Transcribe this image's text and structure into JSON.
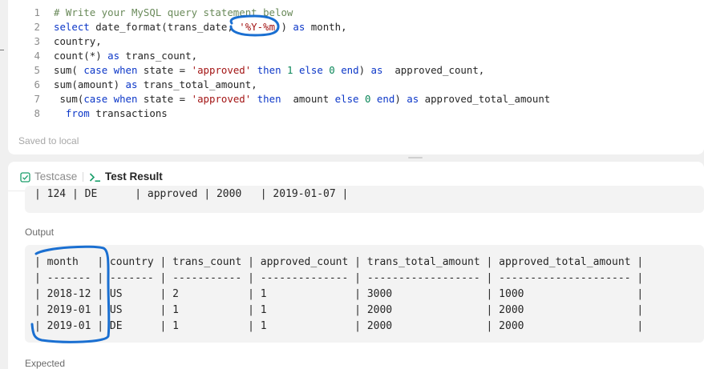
{
  "editor": {
    "lines": [
      {
        "no": "1",
        "tokens": [
          {
            "t": "# Write your MySQL query statement below",
            "c": "tok-comment"
          }
        ]
      },
      {
        "no": "2",
        "tokens": [
          {
            "t": "select",
            "c": "tok-kw"
          },
          {
            "t": " date_format(trans_date, ",
            "c": ""
          },
          {
            "t": "'%Y-%m'",
            "c": "tok-str"
          },
          {
            "t": ") ",
            "c": ""
          },
          {
            "t": "as",
            "c": "tok-kw"
          },
          {
            "t": " month,",
            "c": ""
          }
        ]
      },
      {
        "no": "3",
        "tokens": [
          {
            "t": "country,",
            "c": ""
          }
        ]
      },
      {
        "no": "4",
        "tokens": [
          {
            "t": "count(*) ",
            "c": ""
          },
          {
            "t": "as",
            "c": "tok-kw"
          },
          {
            "t": " trans_count,",
            "c": ""
          }
        ]
      },
      {
        "no": "5",
        "tokens": [
          {
            "t": "sum( ",
            "c": ""
          },
          {
            "t": "case",
            "c": "tok-kw"
          },
          {
            "t": " ",
            "c": ""
          },
          {
            "t": "when",
            "c": "tok-kw"
          },
          {
            "t": " state = ",
            "c": ""
          },
          {
            "t": "'approved'",
            "c": "tok-str"
          },
          {
            "t": " ",
            "c": ""
          },
          {
            "t": "then",
            "c": "tok-kw"
          },
          {
            "t": " ",
            "c": ""
          },
          {
            "t": "1",
            "c": "tok-num"
          },
          {
            "t": " ",
            "c": ""
          },
          {
            "t": "else",
            "c": "tok-kw"
          },
          {
            "t": " ",
            "c": ""
          },
          {
            "t": "0",
            "c": "tok-num"
          },
          {
            "t": " ",
            "c": ""
          },
          {
            "t": "end",
            "c": "tok-kw"
          },
          {
            "t": ") ",
            "c": ""
          },
          {
            "t": "as",
            "c": "tok-kw"
          },
          {
            "t": "  approved_count,",
            "c": ""
          }
        ]
      },
      {
        "no": "6",
        "tokens": [
          {
            "t": "sum(amount) ",
            "c": ""
          },
          {
            "t": "as",
            "c": "tok-kw"
          },
          {
            "t": " trans_total_amount,",
            "c": ""
          }
        ]
      },
      {
        "no": "7",
        "tokens": [
          {
            "t": " sum(",
            "c": ""
          },
          {
            "t": "case",
            "c": "tok-kw"
          },
          {
            "t": " ",
            "c": ""
          },
          {
            "t": "when",
            "c": "tok-kw"
          },
          {
            "t": " state = ",
            "c": ""
          },
          {
            "t": "'approved'",
            "c": "tok-str"
          },
          {
            "t": " ",
            "c": ""
          },
          {
            "t": "then",
            "c": "tok-kw"
          },
          {
            "t": "  amount ",
            "c": ""
          },
          {
            "t": "else",
            "c": "tok-kw"
          },
          {
            "t": " ",
            "c": ""
          },
          {
            "t": "0",
            "c": "tok-num"
          },
          {
            "t": " ",
            "c": ""
          },
          {
            "t": "end",
            "c": "tok-kw"
          },
          {
            "t": ") ",
            "c": ""
          },
          {
            "t": "as",
            "c": "tok-kw"
          },
          {
            "t": " approved_total_amount",
            "c": ""
          }
        ]
      },
      {
        "no": "8",
        "tokens": [
          {
            "t": "  ",
            "c": ""
          },
          {
            "t": "from",
            "c": "tok-kw"
          },
          {
            "t": " transactions",
            "c": ""
          }
        ]
      }
    ],
    "saved_status": "Saved to local"
  },
  "tabs": {
    "testcase_label": "Testcase",
    "result_label": "Test Result"
  },
  "input": {
    "visible_line": "| 124 | DE      | approved | 2000   | 2019-01-07 |"
  },
  "output": {
    "label": "Output",
    "lines": [
      "| month   | country | trans_count | approved_count | trans_total_amount | approved_total_amount |",
      "| ------- | ------- | ----------- | -------------- | ------------------ | --------------------- |",
      "| 2018-12 | US      | 2           | 1              | 3000               | 1000                  |",
      "| 2019-01 | US      | 1           | 1              | 2000               | 2000                  |",
      "| 2019-01 | DE      | 1           | 1              | 2000               | 2000                  |"
    ]
  },
  "expected": {
    "label": "Expected"
  },
  "colors": {
    "annotation": "#1a6fd1",
    "keyword": "#0c37c8",
    "string": "#a31515",
    "number": "#098658",
    "comment": "#6a8a5a",
    "result_tab_icon": "#1a9e6a"
  }
}
